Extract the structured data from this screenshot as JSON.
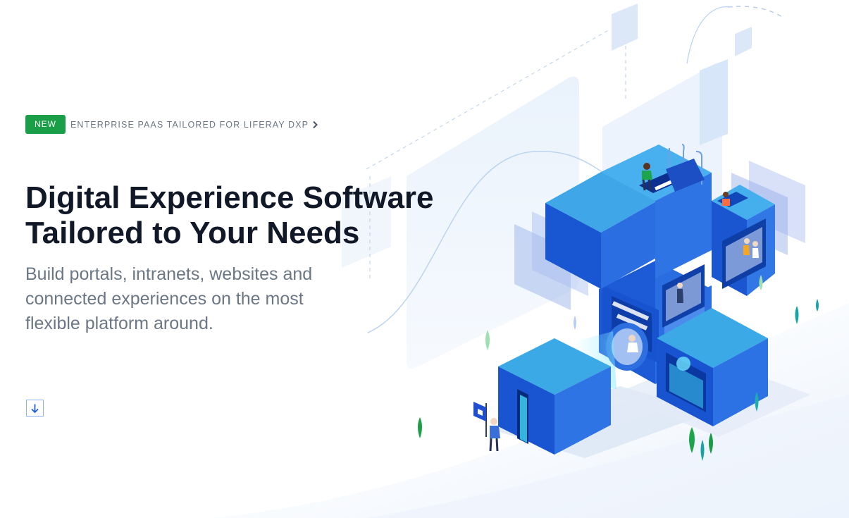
{
  "hero": {
    "badge": "NEW",
    "announcement": "ENTERPRISE PAAS TAILORED FOR LIFERAY DXP",
    "title_lines": [
      "Digital Experience Software",
      "Tailored to Your Needs"
    ],
    "subtitle_lines": [
      "Build portals, intranets, websites and",
      "connected experiences on the most",
      "flexible platform around."
    ],
    "scroll_icon": "arrow-down-icon",
    "announcement_icon": "chevron-right-icon",
    "illustration": "isometric-blue-cubes-with-people"
  },
  "colors": {
    "badge_bg": "#1a9e47",
    "title": "#111827",
    "body_text": "#6b7785",
    "accent_blue": "#1f5fd6",
    "cube_light": "#3ba9e6"
  }
}
